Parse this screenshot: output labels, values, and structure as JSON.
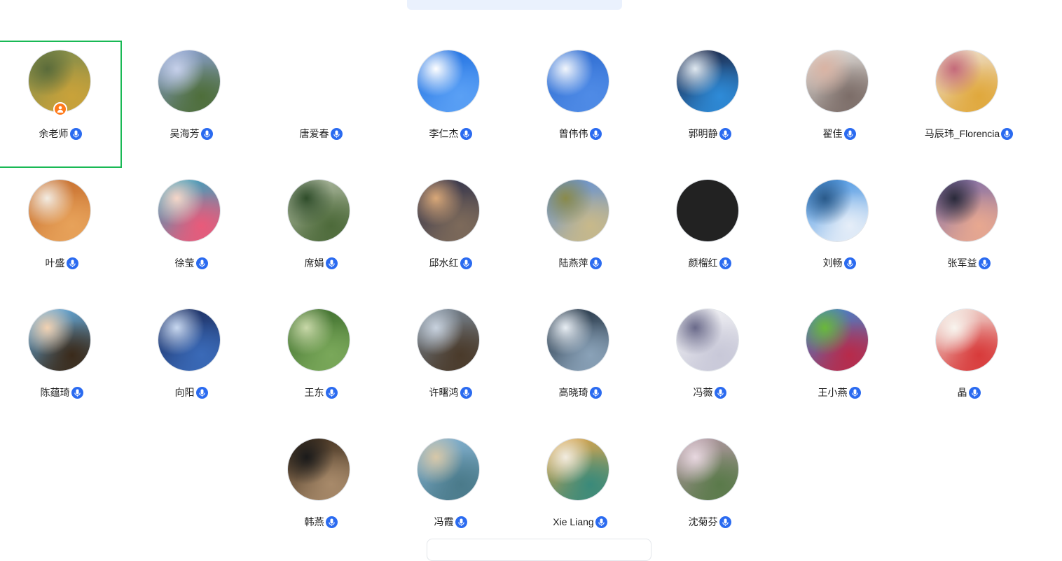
{
  "participants": [
    {
      "name": "余老师",
      "avatar": [
        "#7a8a4c",
        "#c9a23a",
        "#5a6b3a"
      ],
      "host": true,
      "selected": true
    },
    {
      "name": "吴海芳",
      "avatar": [
        "#8da2d8",
        "#4e6e3a",
        "#c6d0ea"
      ]
    },
    {
      "name": "唐爱春",
      "avatar": null
    },
    {
      "name": "李仁杰",
      "avatar": [
        "#1f6fe0",
        "#5aa0f5",
        "#ffffff"
      ]
    },
    {
      "name": "曾伟伟",
      "avatar": [
        "#2d6bd0",
        "#4f8be6",
        "#f2f6fc"
      ]
    },
    {
      "name": "郭明静",
      "avatar": [
        "#1a1d3a",
        "#2e8bd8",
        "#dfe8f0"
      ]
    },
    {
      "name": "翟佳",
      "avatar": [
        "#e9e6e2",
        "#7c6d68",
        "#d9b3a3"
      ]
    },
    {
      "name": "马辰玮_Florencia",
      "avatar": [
        "#efe3d6",
        "#e0a83c",
        "#c46a7a"
      ]
    },
    {
      "name": "叶盛",
      "avatar": [
        "#c46a2a",
        "#e7a25a",
        "#f3ece2"
      ]
    },
    {
      "name": "徐莹",
      "avatar": [
        "#2ba8c4",
        "#e95a7a",
        "#f6d6c8"
      ]
    },
    {
      "name": "席娟",
      "avatar": [
        "#b5bfa8",
        "#4d6a3a",
        "#2f4d2a"
      ]
    },
    {
      "name": "邱水红",
      "avatar": [
        "#2d2f4a",
        "#7d6a5a",
        "#d9a878"
      ]
    },
    {
      "name": "陆燕萍",
      "avatar": [
        "#5d8ed8",
        "#c8b98a",
        "#8a8a4a"
      ]
    },
    {
      "name": "颜榴红",
      "avatar": [
        "#222222",
        "#222222",
        "#222222"
      ]
    },
    {
      "name": "刘畅",
      "avatar": [
        "#3d8ee0",
        "#e6eef8",
        "#2a5a8a"
      ]
    },
    {
      "name": "张军益",
      "avatar": [
        "#7a6aa8",
        "#e8a890",
        "#2a2a3a"
      ]
    },
    {
      "name": "陈蕴琦",
      "avatar": [
        "#6ab8f0",
        "#3a2a1a",
        "#f2d2b2"
      ]
    },
    {
      "name": "向阳",
      "avatar": [
        "#1a2a5a",
        "#3a6ab8",
        "#c8d8f0"
      ]
    },
    {
      "name": "王东",
      "avatar": [
        "#3a6a2a",
        "#7aa85a",
        "#c8d8a8"
      ]
    },
    {
      "name": "许曙鸿",
      "avatar": [
        "#7a8a9a",
        "#4a3a2a",
        "#c8d2de"
      ]
    },
    {
      "name": "高晓琦",
      "avatar": [
        "#1a2a3a",
        "#8aa2b8",
        "#e8eef4"
      ]
    },
    {
      "name": "冯薇",
      "avatar": [
        "#f4f4f6",
        "#c8c8d8",
        "#6a6a8a"
      ]
    },
    {
      "name": "王小燕",
      "avatar": [
        "#3a8ad8",
        "#b82a4a",
        "#6ab83a"
      ]
    },
    {
      "name": "晶",
      "avatar": [
        "#f2e8e0",
        "#d83a3a",
        "#f8f4ee"
      ]
    },
    {
      "name": "韩燕",
      "avatar": [
        "#3a2a1a",
        "#a88a6a",
        "#1a1a1a"
      ]
    },
    {
      "name": "冯霞",
      "avatar": [
        "#8ab8d8",
        "#4a7a8a",
        "#d8c8a8"
      ]
    },
    {
      "name": "Xie  Liang",
      "avatar": [
        "#e8a84a",
        "#3a8a7a",
        "#f2ece0"
      ]
    },
    {
      "name": "沈菊芬",
      "avatar": [
        "#b89aa8",
        "#5a7a4a",
        "#e8d8e0"
      ]
    }
  ],
  "colors": {
    "accent_blue": "#2b6bf0",
    "host_orange": "#ff7a1a",
    "selected_green": "#19b955"
  },
  "icons": {
    "mic": "microphone-icon",
    "host": "host-person-icon"
  }
}
